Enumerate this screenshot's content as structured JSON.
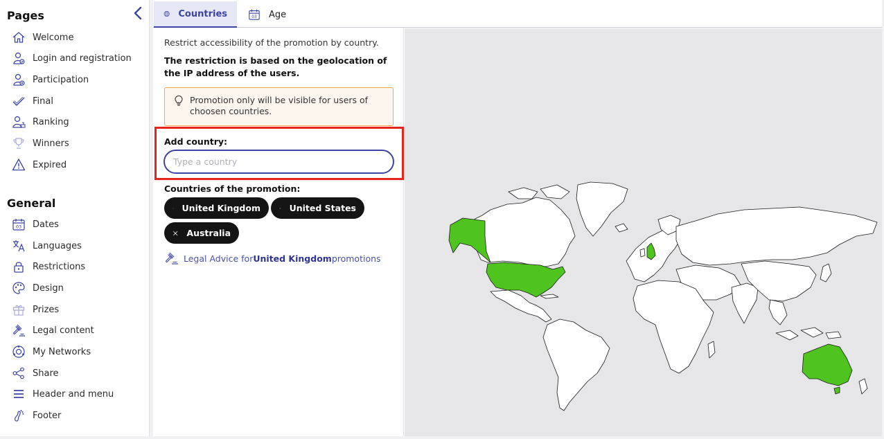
{
  "sidebar": {
    "pages_title": "Pages",
    "general_title": "General",
    "pages_items": [
      {
        "label": "Welcome",
        "icon": "home-icon"
      },
      {
        "label": "Login and registration",
        "icon": "user-login-icon"
      },
      {
        "label": "Participation",
        "icon": "user-add-icon"
      },
      {
        "label": "Final",
        "icon": "check-icon"
      },
      {
        "label": "Ranking",
        "icon": "ranking-icon"
      },
      {
        "label": "Winners",
        "icon": "trophy-icon"
      },
      {
        "label": "Expired",
        "icon": "warning-icon"
      }
    ],
    "general_items": [
      {
        "label": "Dates",
        "icon": "calendar-icon"
      },
      {
        "label": "Languages",
        "icon": "translate-icon"
      },
      {
        "label": "Restrictions",
        "icon": "lock-icon"
      },
      {
        "label": "Design",
        "icon": "palette-icon"
      },
      {
        "label": "Prizes",
        "icon": "gift-icon"
      },
      {
        "label": "Legal content",
        "icon": "gavel-icon"
      },
      {
        "label": "My Networks",
        "icon": "networks-icon"
      },
      {
        "label": "Share",
        "icon": "share-icon"
      },
      {
        "label": "Header and menu",
        "icon": "menu-icon"
      },
      {
        "label": "Footer",
        "icon": "footer-icon"
      }
    ]
  },
  "tabs": {
    "countries": "Countries",
    "age": "Age",
    "age_icon_day": "03"
  },
  "restrictions": {
    "intro": "Restrict accessibility of the promotion by country.",
    "intro_bold": "The restriction is based on the geolocation of the IP address of the users.",
    "notice": "Promotion only will be visible for users of choosen countries.",
    "add_label": "Add country:",
    "add_placeholder": "Type a country",
    "add_value": "",
    "countries_label": "Countries of the promotion:",
    "countries": [
      "United Kingdom",
      "United States",
      "Australia"
    ],
    "legal_prefix": "Legal Advice for ",
    "legal_country": "United Kingdom",
    "legal_suffix": " promotions"
  },
  "map": {
    "selected_color": "#4fc41f",
    "land_color": "#ffffff",
    "ocean_color": "#e6e6e8"
  },
  "theme": {
    "accent": "#3d43a3",
    "highlight": "#e8231b",
    "notice_border": "#f0a74a"
  }
}
